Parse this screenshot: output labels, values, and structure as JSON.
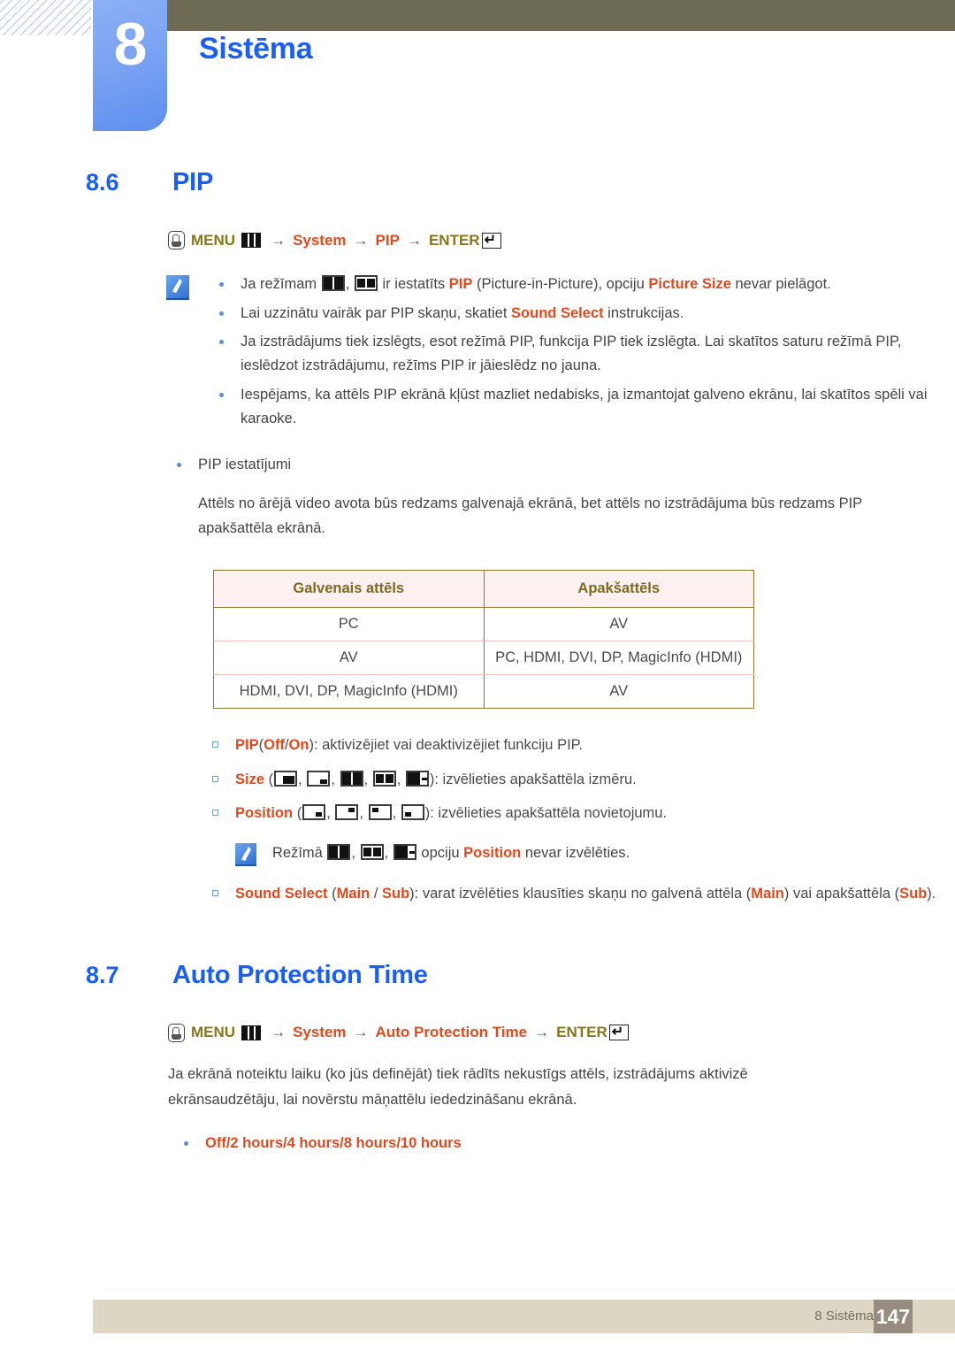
{
  "header": {
    "chapter_number": "8",
    "chapter_title": "Sistēma"
  },
  "sections": [
    {
      "number": "8.6",
      "title": "PIP",
      "menu_path": {
        "menu_label": "MENU",
        "step_system": "System",
        "step_pip": "PIP",
        "enter_label": "ENTER",
        "arrow": "→"
      },
      "notes": [
        {
          "pre": "Ja režīmam",
          "mid": ", ",
          "post1": "ir iestatīts",
          "kw1": "PIP",
          "post2": "(Picture-in-Picture), opciju",
          "kw2": "Picture Size",
          "post3": "nevar pielāgot."
        },
        {
          "pre": "Lai uzzinātu vairāk par PIP skaņu, skatiet",
          "kw": "Sound Select",
          "post": "instrukcijas."
        },
        {
          "text": "Ja izstrādājums tiek izslēgts, esot režīmā PIP, funkcija PIP tiek izslēgta. Lai skatītos saturu režīmā PIP, ieslēdzot izstrādājumu, režīms PIP ir jāieslēdz no jauna."
        },
        {
          "text": "Iespējams, ka attēls PIP ekrānā kļūst mazliet nedabisks, ja izmantojat galveno ekrānu, lai skatītos spēli vai karaoke."
        }
      ],
      "settings_bullet": "PIP iestatījumi",
      "settings_para": "Attēls no ārējā video avota būs redzams galvenajā ekrānā, bet attēls no izstrādājuma būs redzams PIP apakšattēla ekrānā.",
      "table": {
        "headers": [
          "Galvenais attēls",
          "Apakšattēls"
        ],
        "rows": [
          [
            "PC",
            "AV"
          ],
          [
            "AV",
            "PC, HDMI, DVI, DP, MagicInfo (HDMI)"
          ],
          [
            "HDMI, DVI, DP, MagicInfo (HDMI)",
            "AV"
          ]
        ]
      },
      "options": {
        "pip": {
          "label": "PIP",
          "open_paren": "(",
          "opt_off": "Off",
          "slash": "/",
          "opt_on": "On",
          "close_paren": ")",
          "desc": ": aktivizējiet vai deaktivizējiet funkciju PIP."
        },
        "size": {
          "label": "Size",
          "open_paren": "(",
          "close_paren": ")",
          "desc": ": izvēlieties apakšattēla izmēru.",
          "comma": ","
        },
        "position": {
          "label": "Position",
          "open_paren": "(",
          "close_paren": ")",
          "desc": ": izvēlieties apakšattēla novietojumu.",
          "comma": ","
        },
        "position_note": {
          "pre": "Režīmā",
          "comma": ",",
          "mid": "opciju",
          "kw": "Position",
          "post": "nevar izvēlēties."
        },
        "sound_select": {
          "label": "Sound Select",
          "open_paren": "(",
          "opt_main": "Main",
          "slash": "/",
          "opt_sub": "Sub",
          "close_paren": ")",
          "desc1": ": varat izvēlēties klausīties skaņu no galvenā attēla (",
          "kw_main": "Main",
          "desc2": ") vai apakšattēla (",
          "kw_sub": "Sub",
          "desc3": ")."
        }
      }
    },
    {
      "number": "8.7",
      "title": "Auto Protection Time",
      "menu_path": {
        "menu_label": "MENU",
        "step_system": "System",
        "step_target": "Auto Protection Time",
        "enter_label": "ENTER",
        "arrow": "→"
      },
      "body": "Ja ekrānā noteiktu laiku (ko jūs definējāt) tiek rādīts nekustīgs attēls, izstrādājums aktivizē ekrānsaudzētāju, lai novērstu māņattēlu iededzināšanu ekrānā.",
      "option_line": "Off/2 hours/4 hours/8 hours/10 hours"
    }
  ],
  "footer": {
    "label": "8 Sistēma",
    "page": "147"
  },
  "colors": {
    "accent_blue": "#1b5ff0",
    "orange": "#e2491d",
    "olive_text": "#8a7519",
    "olive_bar": "#6e6b54",
    "table_header_bg": "#fcf0f0",
    "table_border": "#8a7a2a",
    "footer_bg": "#dcd6c2",
    "footer_page_bg": "#988b80"
  }
}
